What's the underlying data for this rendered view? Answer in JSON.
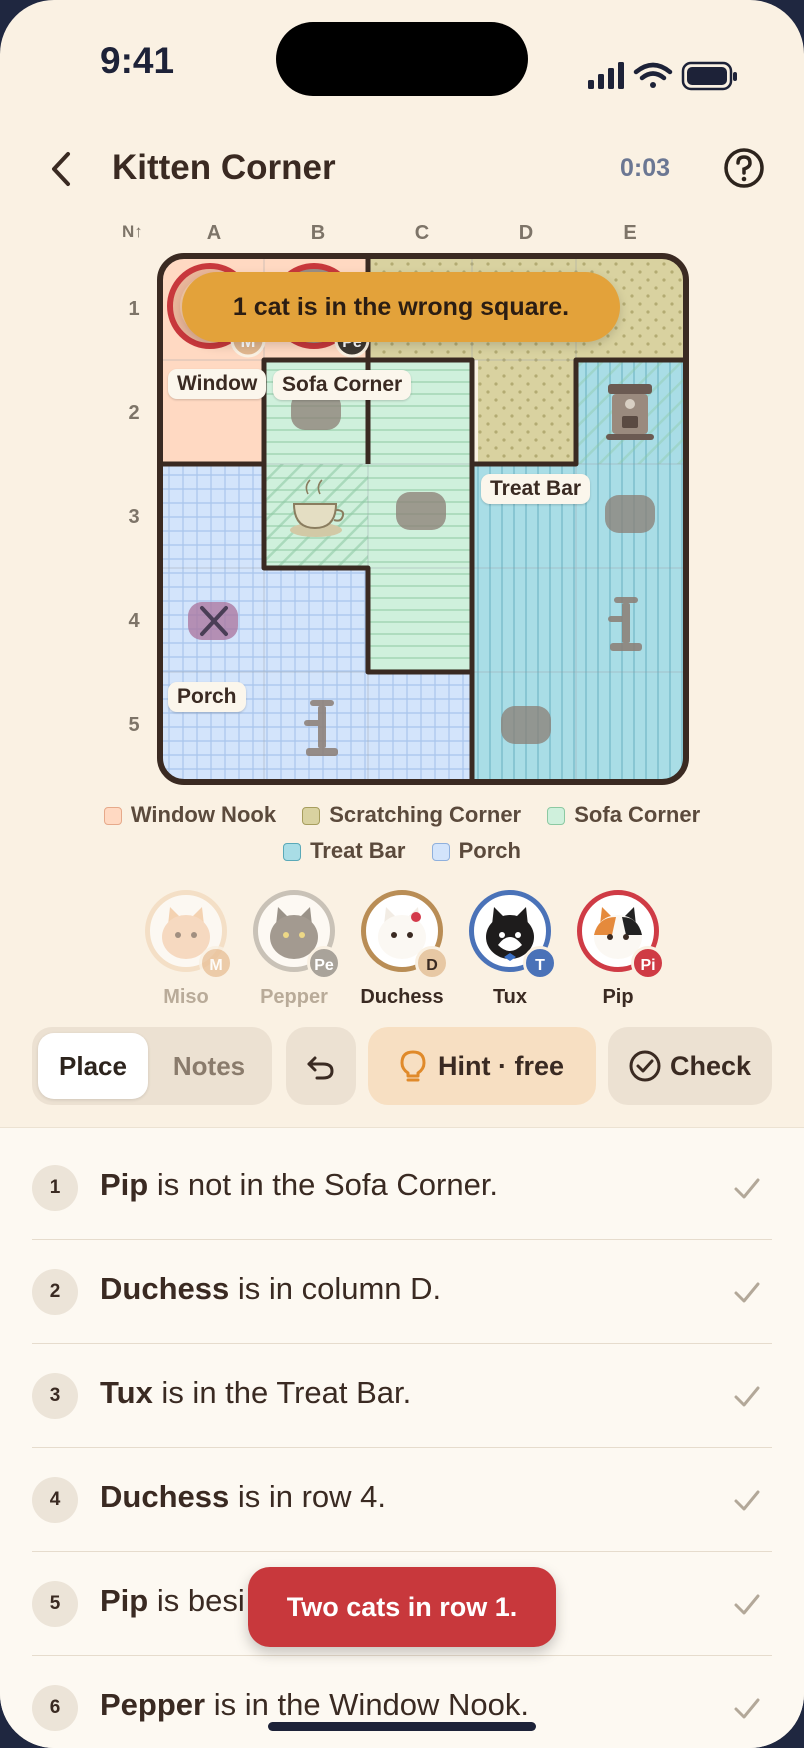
{
  "status": {
    "time": "9:41"
  },
  "header": {
    "title": "Kitten Corner",
    "timer": "0:03"
  },
  "grid": {
    "compass": "N↑",
    "columns": [
      "A",
      "B",
      "C",
      "D",
      "E"
    ],
    "rows": [
      "1",
      "2",
      "3",
      "4",
      "5"
    ],
    "region_tags": [
      "Window",
      "Sofa Corner",
      "Treat Bar",
      "Porch"
    ],
    "placed_badges": [
      "M",
      "Pe"
    ]
  },
  "toast_top": "1 cat is in the wrong square.",
  "legend": [
    {
      "label": "Window Nook",
      "fill": "#ffd9c2",
      "stroke": "#e6a98a"
    },
    {
      "label": "Scratching Corner",
      "fill": "#d9d2a0",
      "stroke": "#a79e5e"
    },
    {
      "label": "Sofa Corner",
      "fill": "#cff0dc",
      "stroke": "#8cc9a2"
    },
    {
      "label": "Treat Bar",
      "fill": "#a9dde6",
      "stroke": "#5aa9b8"
    },
    {
      "label": "Porch",
      "fill": "#d3e4fb",
      "stroke": "#8fb0dd"
    }
  ],
  "cats": [
    {
      "name": "Miso",
      "badge": "M",
      "ring": "#f0d2b0",
      "badge_color": "#e9c29a",
      "name_color": "#b9ab99"
    },
    {
      "name": "Pepper",
      "badge": "Pe",
      "ring": "#a9a39a",
      "badge_color": "#a9a39a",
      "name_color": "#b9ab99"
    },
    {
      "name": "Duchess",
      "badge": "D",
      "ring": "#b98d55",
      "badge_color": "#e7c8a4",
      "name_color": "#3a2a22"
    },
    {
      "name": "Tux",
      "badge": "T",
      "ring": "#4a72b8",
      "badge_color": "#4a72b8",
      "name_color": "#3a2a22"
    },
    {
      "name": "Pip",
      "badge": "Pi",
      "ring": "#cf3b45",
      "badge_color": "#cf3b45",
      "name_color": "#3a2a22"
    }
  ],
  "controls": {
    "place": "Place",
    "notes": "Notes",
    "hint": "Hint · free",
    "check": "Check"
  },
  "clues": [
    {
      "num": "1",
      "subject": "Pip",
      "rest": " is not in the Sofa Corner."
    },
    {
      "num": "2",
      "subject": "Duchess",
      "rest": " is in column D."
    },
    {
      "num": "3",
      "subject": "Tux",
      "rest": " is in the Treat Bar."
    },
    {
      "num": "4",
      "subject": "Duchess",
      "rest": " is in row 4."
    },
    {
      "num": "5",
      "subject": "Pip",
      "rest": " is besi"
    },
    {
      "num": "6",
      "subject": "Pepper",
      "rest": " is in the Window Nook."
    }
  ],
  "toast_bottom": "Two cats in row 1."
}
